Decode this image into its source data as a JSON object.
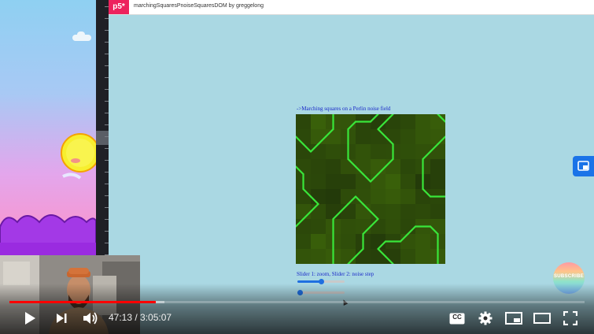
{
  "editor": {
    "logo_text": "p5*",
    "sketch_title": "marchingSquaresPnoiseSquaresDOM  by greggelong"
  },
  "sketch": {
    "caption": "->Marching squares on a Perlin noise field",
    "slider_caption": "Slider 1: zoom, Slider 2: noise step",
    "slider_zoom": 0.5,
    "slider_noise_step": 0.05,
    "line_color": "#39e63a"
  },
  "player": {
    "time": "47:13 / 3:05:07",
    "progress_fraction": 0.255,
    "buffered_fraction": 0.27,
    "subscribe_text": "SUBSCRIBE",
    "play_icon": "play-icon",
    "next_icon": "next-icon",
    "volume_icon": "volume-icon",
    "cc_label": "CC",
    "settings_icon": "gear-icon",
    "miniplayer_icon": "miniplayer-icon",
    "theater_icon": "theater-icon",
    "fullscreen_icon": "fullscreen-icon",
    "accent_color": "#ff0000"
  }
}
